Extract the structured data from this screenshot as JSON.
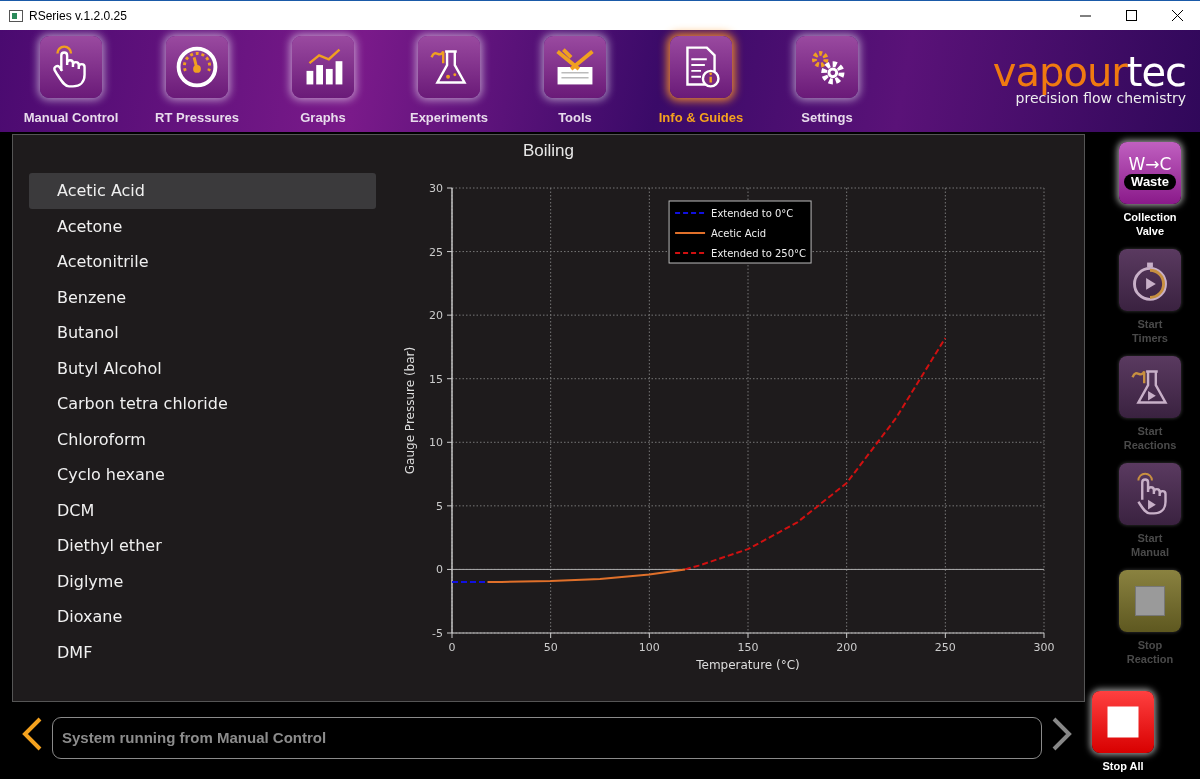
{
  "window": {
    "title": "RSeries v.1.2.0.25"
  },
  "nav": [
    {
      "label": "Manual Control",
      "selected": false
    },
    {
      "label": "RT Pressures",
      "selected": false
    },
    {
      "label": "Graphs",
      "selected": false
    },
    {
      "label": "Experiments",
      "selected": false
    },
    {
      "label": "Tools",
      "selected": false
    },
    {
      "label": "Info & Guides",
      "selected": true
    },
    {
      "label": "Settings",
      "selected": false
    }
  ],
  "logo": {
    "brand_a": "vapour",
    "brand_b": "tec",
    "tagline": "precision flow chemistry"
  },
  "panel": {
    "title": "Boiling",
    "solvents": [
      {
        "label": "Acetic Acid",
        "selected": true
      },
      {
        "label": "Acetone",
        "selected": false
      },
      {
        "label": "Acetonitrile",
        "selected": false
      },
      {
        "label": "Benzene",
        "selected": false
      },
      {
        "label": "Butanol",
        "selected": false
      },
      {
        "label": "Butyl Alcohol",
        "selected": false
      },
      {
        "label": "Carbon tetra chloride",
        "selected": false
      },
      {
        "label": "Chloroform",
        "selected": false
      },
      {
        "label": "Cyclo hexane",
        "selected": false
      },
      {
        "label": "DCM",
        "selected": false
      },
      {
        "label": "Diethyl ether",
        "selected": false
      },
      {
        "label": "Diglyme",
        "selected": false
      },
      {
        "label": "Dioxane",
        "selected": false
      },
      {
        "label": "DMF",
        "selected": false
      }
    ],
    "chart_data": {
      "type": "line",
      "xlabel": "Temperature (°C)",
      "ylabel": "Gauge Pressure (bar)",
      "x": [
        0,
        10,
        18,
        25,
        50,
        75,
        100,
        118,
        125,
        150,
        175,
        200,
        225,
        250
      ],
      "series": [
        {
          "name": "Extended to 0°C",
          "color": "#1010e0",
          "line_style": "dashed",
          "values": [
            -1,
            -1,
            -1,
            null,
            null,
            null,
            null,
            null,
            null,
            null,
            null,
            null,
            null,
            null
          ]
        },
        {
          "name": "Acetic Acid",
          "color": "#e0702a",
          "line_style": "solid",
          "values": [
            null,
            null,
            -1,
            -0.98,
            -0.92,
            -0.75,
            -0.4,
            0,
            null,
            null,
            null,
            null,
            null,
            null
          ]
        },
        {
          "name": "Extended to 250°C",
          "color": "#d01010",
          "line_style": "dashed",
          "values": [
            null,
            null,
            null,
            null,
            null,
            null,
            null,
            0,
            0.3,
            1.6,
            3.7,
            6.8,
            11.9,
            18.2
          ]
        }
      ],
      "grid": true,
      "legend": true,
      "xlim": [
        0,
        300
      ],
      "ylim": [
        -5,
        30
      ],
      "xticks": [
        0,
        50,
        100,
        150,
        200,
        250,
        300
      ],
      "yticks": [
        -5,
        0,
        5,
        10,
        15,
        20,
        25,
        30
      ]
    }
  },
  "valve": {
    "top": "W→C",
    "state": "Waste",
    "label_1": "Collection",
    "label_2": "Valve"
  },
  "actions": [
    {
      "kind": "timer",
      "label_1": "Start",
      "label_2": "Timers",
      "disabled": true
    },
    {
      "kind": "flask",
      "label_1": "Start",
      "label_2": "Reactions",
      "disabled": true
    },
    {
      "kind": "hand",
      "label_1": "Start",
      "label_2": "Manual",
      "disabled": true
    },
    {
      "kind": "stop-reaction",
      "label_1": "Stop",
      "label_2": "Reaction",
      "disabled": true
    },
    {
      "kind": "stop-all",
      "label_1": "Stop All",
      "disabled": false
    }
  ],
  "status": {
    "message": "System running from Manual Control"
  }
}
